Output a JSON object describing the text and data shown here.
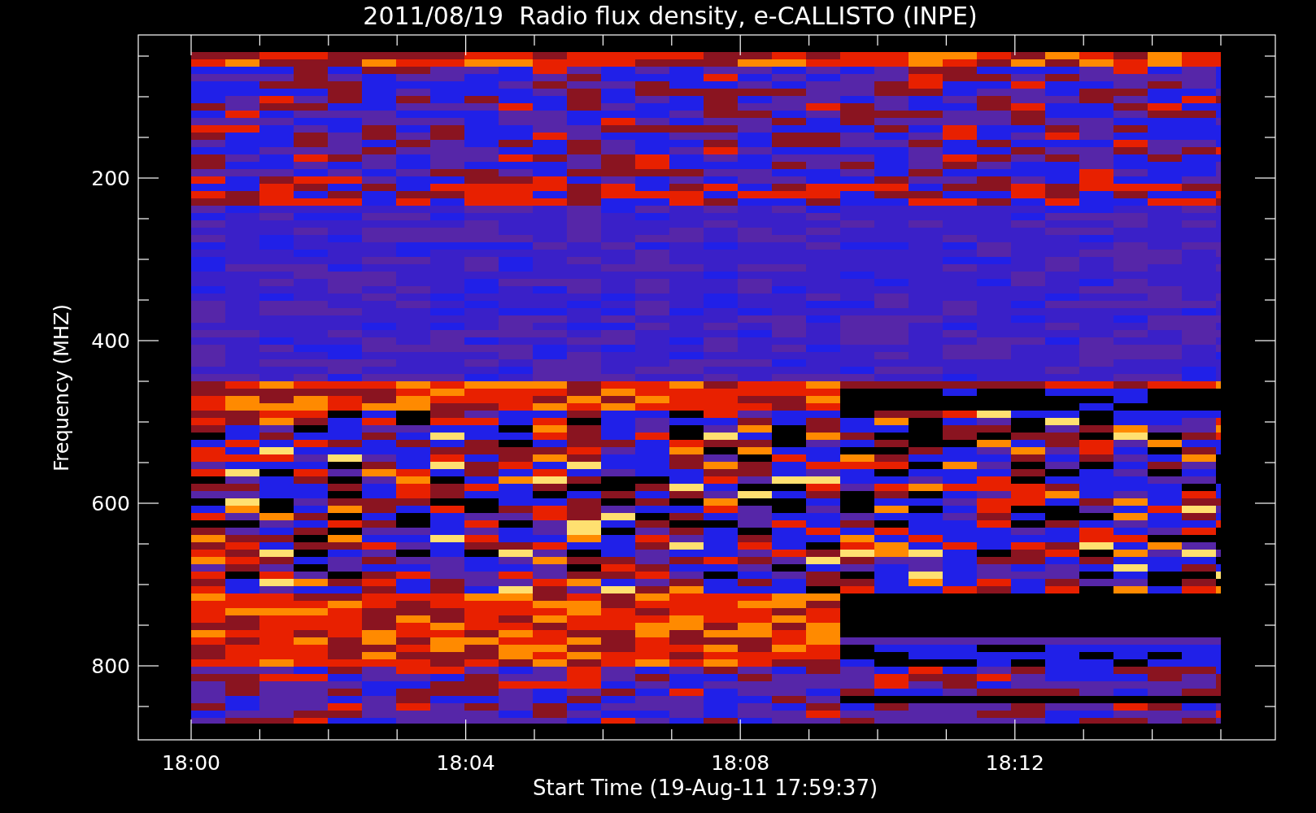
{
  "title": "2011/08/19  Radio flux density, e-CALLISTO (INPE)",
  "y_axis": {
    "label": "Frequency (MHZ)",
    "ticks": [
      "200",
      "400",
      "600",
      "800"
    ]
  },
  "x_axis": {
    "label": "Start Time (19-Aug-11 17:59:37)",
    "ticks": [
      "18:00",
      "18:04",
      "18:08",
      "18:12"
    ]
  }
}
